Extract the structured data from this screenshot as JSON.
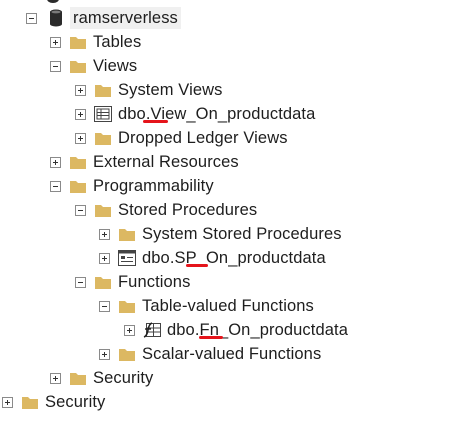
{
  "tree": {
    "database": {
      "label": "ramserverless"
    },
    "tables": {
      "label": "Tables"
    },
    "views": {
      "label": "Views"
    },
    "system_views": {
      "label": "System Views"
    },
    "view_item": {
      "label": "dbo.View_On_productdata"
    },
    "dropped_ledger_views": {
      "label": "Dropped Ledger Views"
    },
    "external_resources": {
      "label": "External Resources"
    },
    "programmability": {
      "label": "Programmability"
    },
    "stored_procedures": {
      "label": "Stored Procedures"
    },
    "system_stored_procedures": {
      "label": "System Stored Procedures"
    },
    "sp_item": {
      "label": "dbo.SP_On_productdata"
    },
    "functions": {
      "label": "Functions"
    },
    "table_valued_functions": {
      "label": "Table-valued Functions"
    },
    "fn_item": {
      "label": "dbo.Fn_On_productdata"
    },
    "scalar_valued_functions": {
      "label": "Scalar-valued Functions"
    },
    "db_security": {
      "label": "Security"
    },
    "server_security": {
      "label": "Security"
    }
  },
  "colors": {
    "folder": "#dcb862",
    "highlight_underline": "#e5141b",
    "selection_bg": "#f0f0f0"
  }
}
